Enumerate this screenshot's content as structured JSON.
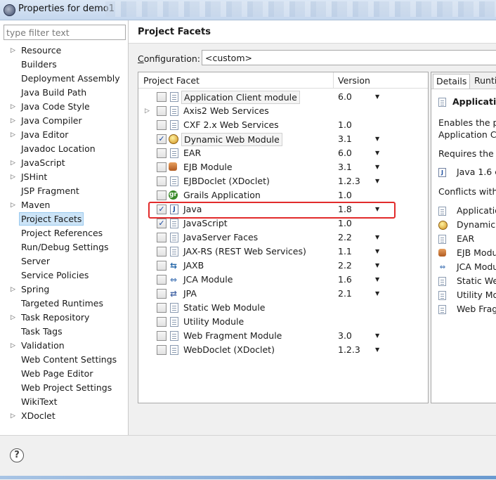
{
  "window": {
    "title": "Properties for demo1"
  },
  "left": {
    "filter_placeholder": "type filter text",
    "items": [
      {
        "label": "Resource",
        "expandable": true
      },
      {
        "label": "Builders",
        "expandable": false
      },
      {
        "label": "Deployment Assembly",
        "expandable": false
      },
      {
        "label": "Java Build Path",
        "expandable": false
      },
      {
        "label": "Java Code Style",
        "expandable": true
      },
      {
        "label": "Java Compiler",
        "expandable": true
      },
      {
        "label": "Java Editor",
        "expandable": true
      },
      {
        "label": "Javadoc Location",
        "expandable": false
      },
      {
        "label": "JavaScript",
        "expandable": true
      },
      {
        "label": "JSHint",
        "expandable": true
      },
      {
        "label": "JSP Fragment",
        "expandable": false
      },
      {
        "label": "Maven",
        "expandable": true
      },
      {
        "label": "Project Facets",
        "expandable": false,
        "selected": true
      },
      {
        "label": "Project References",
        "expandable": false
      },
      {
        "label": "Run/Debug Settings",
        "expandable": false
      },
      {
        "label": "Server",
        "expandable": false
      },
      {
        "label": "Service Policies",
        "expandable": false
      },
      {
        "label": "Spring",
        "expandable": true
      },
      {
        "label": "Targeted Runtimes",
        "expandable": false
      },
      {
        "label": "Task Repository",
        "expandable": true
      },
      {
        "label": "Task Tags",
        "expandable": false
      },
      {
        "label": "Validation",
        "expandable": true
      },
      {
        "label": "Web Content Settings",
        "expandable": false
      },
      {
        "label": "Web Page Editor",
        "expandable": false
      },
      {
        "label": "Web Project Settings",
        "expandable": false
      },
      {
        "label": "WikiText",
        "expandable": false
      },
      {
        "label": "XDoclet",
        "expandable": true
      }
    ]
  },
  "main": {
    "title": "Project Facets",
    "config_label": "onfiguration:",
    "config_label_mnemonic": "C",
    "config_value": "<custom>",
    "table": {
      "col_facet": "Project Facet",
      "col_version": "Version",
      "rows": [
        {
          "name": "Application Client module",
          "version": "6.0",
          "checked": false,
          "dropdown": true,
          "icon": "doc",
          "boxed": true
        },
        {
          "name": "Axis2 Web Services",
          "version": "",
          "checked": false,
          "dropdown": false,
          "icon": "doc",
          "expandable": true
        },
        {
          "name": "CXF 2.x Web Services",
          "version": "1.0",
          "checked": false,
          "dropdown": false,
          "icon": "doc"
        },
        {
          "name": "Dynamic Web Module",
          "version": "3.1",
          "checked": true,
          "dropdown": true,
          "icon": "globe",
          "boxed": true
        },
        {
          "name": "EAR",
          "version": "6.0",
          "checked": false,
          "dropdown": true,
          "icon": "doc"
        },
        {
          "name": "EJB Module",
          "version": "3.1",
          "checked": false,
          "dropdown": true,
          "icon": "ejb"
        },
        {
          "name": "EJBDoclet (XDoclet)",
          "version": "1.2.3",
          "checked": false,
          "dropdown": true,
          "icon": "doc"
        },
        {
          "name": "Grails Application",
          "version": "1.0",
          "checked": false,
          "dropdown": false,
          "icon": "grails"
        },
        {
          "name": "Java",
          "version": "1.8",
          "checked": true,
          "dropdown": true,
          "icon": "java"
        },
        {
          "name": "JavaScript",
          "version": "1.0",
          "checked": true,
          "dropdown": false,
          "icon": "doc"
        },
        {
          "name": "JavaServer Faces",
          "version": "2.2",
          "checked": false,
          "dropdown": true,
          "icon": "doc"
        },
        {
          "name": "JAX-RS (REST Web Services)",
          "version": "1.1",
          "checked": false,
          "dropdown": true,
          "icon": "doc"
        },
        {
          "name": "JAXB",
          "version": "2.2",
          "checked": false,
          "dropdown": true,
          "icon": "jaxb"
        },
        {
          "name": "JCA Module",
          "version": "1.6",
          "checked": false,
          "dropdown": true,
          "icon": "jca"
        },
        {
          "name": "JPA",
          "version": "2.1",
          "checked": false,
          "dropdown": true,
          "icon": "jpa"
        },
        {
          "name": "Static Web Module",
          "version": "",
          "checked": false,
          "dropdown": false,
          "icon": "doc"
        },
        {
          "name": "Utility Module",
          "version": "",
          "checked": false,
          "dropdown": false,
          "icon": "doc"
        },
        {
          "name": "Web Fragment Module",
          "version": "3.0",
          "checked": false,
          "dropdown": true,
          "icon": "doc"
        },
        {
          "name": "WebDoclet (XDoclet)",
          "version": "1.2.3",
          "checked": false,
          "dropdown": true,
          "icon": "doc"
        }
      ]
    }
  },
  "details": {
    "tab_details": "Details",
    "tab_runtimes": "Runti",
    "heading": "Applicatio",
    "desc_line1": "Enables the pr",
    "desc_line2": "Application Cli",
    "requires_label": "Requires the f",
    "requires_item": "Java 1.6 c",
    "conflicts_label": "Conflicts with t",
    "conflicts": [
      {
        "label": "Applicatio",
        "icon": "doc"
      },
      {
        "label": "Dynamic W",
        "icon": "globe"
      },
      {
        "label": "EAR",
        "icon": "doc"
      },
      {
        "label": "EJB Modu",
        "icon": "ejb"
      },
      {
        "label": "JCA Modu",
        "icon": "jca"
      },
      {
        "label": "Static Wel",
        "icon": "doc"
      },
      {
        "label": "Utility Mo",
        "icon": "doc"
      },
      {
        "label": "Web Frag",
        "icon": "doc"
      }
    ]
  },
  "footer": {
    "help_glyph": "?"
  },
  "colors": {
    "highlight": "#e22b2b",
    "selection": "#cce4f7"
  }
}
